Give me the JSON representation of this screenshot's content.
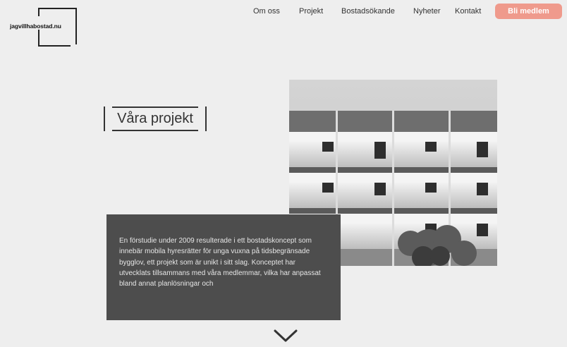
{
  "logo": {
    "text": "jagvillhabostad.nu"
  },
  "nav": {
    "items": [
      {
        "label": "Om oss"
      },
      {
        "label": "Projekt"
      },
      {
        "label": "Bostadsökande"
      },
      {
        "label": "Nyheter"
      },
      {
        "label": "Kontakt"
      }
    ],
    "cta_label": "Bli medlem"
  },
  "hero": {
    "title": "Våra projekt",
    "description": "En förstudie under 2009 resulterade i ett bostadskoncept som innebär mobila hyresrätter för unga vuxna på tidsbegränsade bygglov, ett projekt som är unikt i sitt slag. Konceptet har utvecklats tillsammans med våra medlemmar, vilka har anpassat bland annat planlösningar och"
  },
  "icons": {
    "scroll_down": "chevron-down-icon",
    "photo": "building-photo"
  },
  "colors": {
    "background": "#eeeeee",
    "cta": "#ef9a8c",
    "textbox": "#4d4d4d",
    "text": "#333333"
  }
}
